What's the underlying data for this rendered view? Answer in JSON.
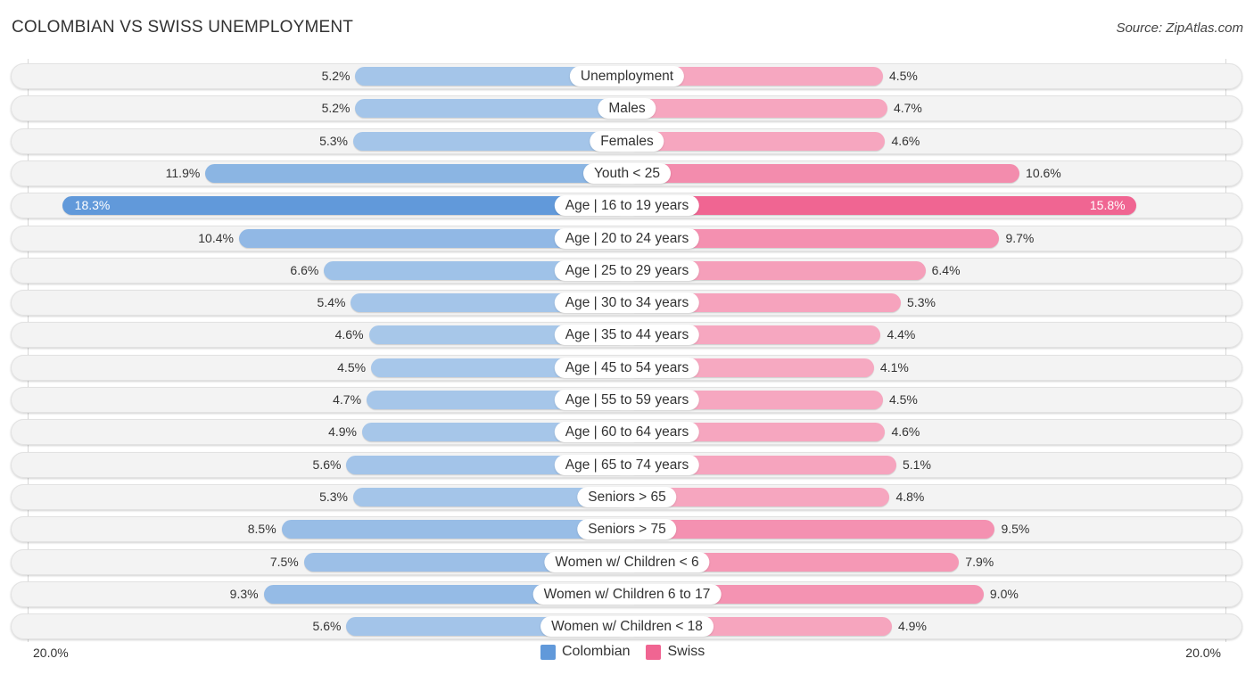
{
  "header": {
    "title": "COLOMBIAN VS SWISS UNEMPLOYMENT",
    "source": "Source: ZipAtlas.com"
  },
  "colors": {
    "colombian_strong": "#6199da",
    "colombian_light": "#a9c8ea",
    "swiss_strong": "#f06592",
    "swiss_light": "#f6a9c1"
  },
  "axis": {
    "left_label": "20.0%",
    "right_label": "20.0%"
  },
  "legend": [
    {
      "name": "Colombian",
      "color": "#6199da"
    },
    {
      "name": "Swiss",
      "color": "#f06592"
    }
  ],
  "chart_data": {
    "type": "bar",
    "orientation": "horizontal-diverging",
    "title": "COLOMBIAN VS SWISS UNEMPLOYMENT",
    "xlabel": "",
    "ylabel": "",
    "xlim": [
      -20,
      20
    ],
    "axis_tick_labels": [
      "20.0%",
      "20.0%"
    ],
    "legend_position": "bottom-center",
    "categories": [
      "Unemployment",
      "Males",
      "Females",
      "Youth < 25",
      "Age | 16 to 19 years",
      "Age | 20 to 24 years",
      "Age | 25 to 29 years",
      "Age | 30 to 34 years",
      "Age | 35 to 44 years",
      "Age | 45 to 54 years",
      "Age | 55 to 59 years",
      "Age | 60 to 64 years",
      "Age | 65 to 74 years",
      "Seniors > 65",
      "Seniors > 75",
      "Women w/ Children < 6",
      "Women w/ Children 6 to 17",
      "Women w/ Children < 18"
    ],
    "series": [
      {
        "name": "Colombian",
        "side": "left",
        "values": [
          5.2,
          5.2,
          5.3,
          11.9,
          18.3,
          10.4,
          6.6,
          5.4,
          4.6,
          4.5,
          4.7,
          4.9,
          5.6,
          5.3,
          8.5,
          7.5,
          9.3,
          5.6
        ],
        "labels": [
          "5.2%",
          "5.2%",
          "5.3%",
          "11.9%",
          "18.3%",
          "10.4%",
          "6.6%",
          "5.4%",
          "4.6%",
          "4.5%",
          "4.7%",
          "4.9%",
          "5.6%",
          "5.3%",
          "8.5%",
          "7.5%",
          "9.3%",
          "5.6%"
        ]
      },
      {
        "name": "Swiss",
        "side": "right",
        "values": [
          4.5,
          4.7,
          4.6,
          10.6,
          15.8,
          9.7,
          6.4,
          5.3,
          4.4,
          4.1,
          4.5,
          4.6,
          5.1,
          4.8,
          9.5,
          7.9,
          9.0,
          4.9
        ],
        "labels": [
          "4.5%",
          "4.7%",
          "4.6%",
          "10.6%",
          "15.8%",
          "9.7%",
          "6.4%",
          "5.3%",
          "4.4%",
          "4.1%",
          "4.5%",
          "4.6%",
          "5.1%",
          "4.8%",
          "9.5%",
          "7.9%",
          "9.0%",
          "4.9%"
        ]
      }
    ]
  }
}
